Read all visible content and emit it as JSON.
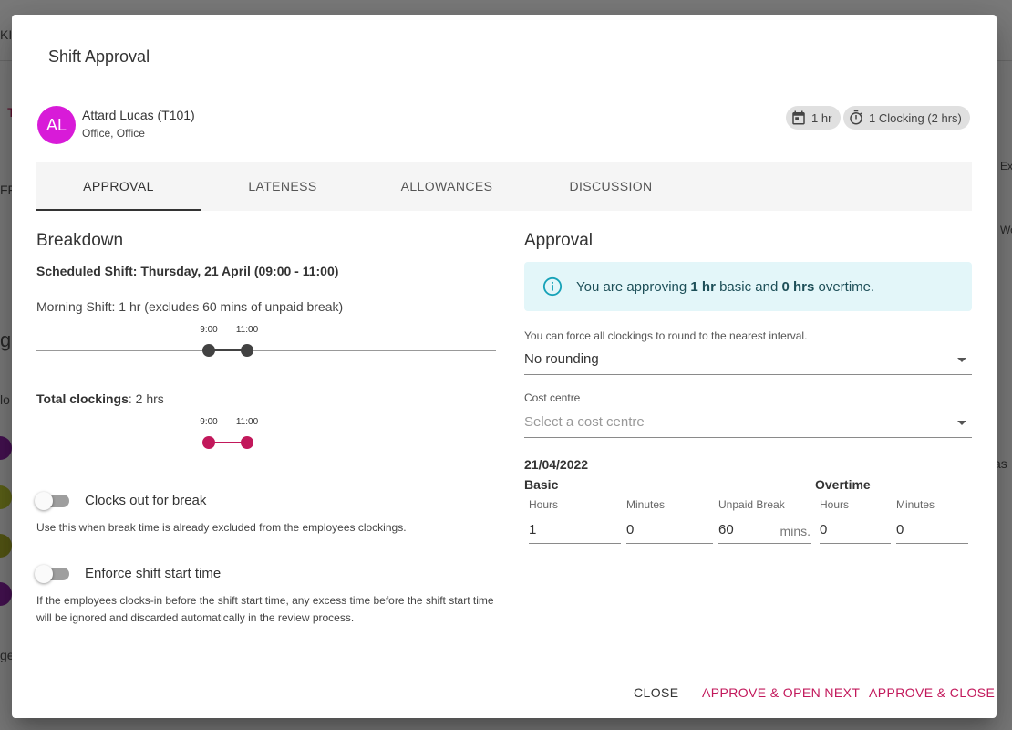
{
  "dialog": {
    "title": "Shift Approval"
  },
  "employee": {
    "initials": "AL",
    "name": "Attard Lucas (T101)",
    "location": "Office, Office",
    "avatar_color": "#d81bd8"
  },
  "chips": [
    {
      "icon": "calendar-icon",
      "label": "1 hr"
    },
    {
      "icon": "stopwatch-icon",
      "label": "1 Clocking (2 hrs)"
    }
  ],
  "tabs": [
    {
      "label": "APPROVAL",
      "active": true
    },
    {
      "label": "LATENESS",
      "active": false
    },
    {
      "label": "ALLOWANCES",
      "active": false
    },
    {
      "label": "DISCUSSION",
      "active": false
    }
  ],
  "breakdown": {
    "heading": "Breakdown",
    "scheduled": "Scheduled Shift: Thursday, 21 April (09:00 - 11:00)",
    "morning": "Morning Shift: 1 hr (excludes 60 mins of unpaid break)",
    "shift_timeline": {
      "start": "9:00",
      "end": "11:00",
      "color": "#424242"
    },
    "clockings_label": "Total clockings",
    "clockings_value": ": 2 hrs",
    "clock_timeline": {
      "start": "9:00",
      "end": "11:00",
      "color": "#c2185b"
    },
    "toggles": [
      {
        "label": "Clocks out for break",
        "on": false,
        "hint": "Use this when break time is already excluded from the employees clockings."
      },
      {
        "label": "Enforce shift start time",
        "on": false,
        "hint": "If the employees clocks-in before the shift start time, any excess time before the shift start time will be ignored and discarded automatically in the review process."
      }
    ]
  },
  "approval": {
    "heading": "Approval",
    "info": {
      "prefix": "You are approving ",
      "basic": "1 hr",
      "mid": " basic and ",
      "overtime": "0 hrs",
      "suffix": " overtime."
    },
    "rounding_hint": "You can force all clockings to round to the nearest interval.",
    "rounding_value": "No rounding",
    "cost_centre_label": "Cost centre",
    "cost_centre_placeholder": "Select a cost centre",
    "date": "21/04/2022",
    "basic_label": "Basic",
    "overtime_label": "Overtime",
    "fields": {
      "hours_label": "Hours",
      "hours": "1",
      "minutes_label": "Minutes",
      "minutes": "0",
      "unpaid_label": "Unpaid Break",
      "unpaid": "60",
      "unpaid_suffix": "mins.",
      "ot_hours_label": "Hours",
      "ot_hours": "0",
      "ot_minutes_label": "Minutes",
      "ot_minutes": "0"
    }
  },
  "actions": {
    "close": "CLOSE",
    "approve_next": "APPROVE & OPEN NEXT",
    "approve_close": "APPROVE & CLOSE"
  }
}
